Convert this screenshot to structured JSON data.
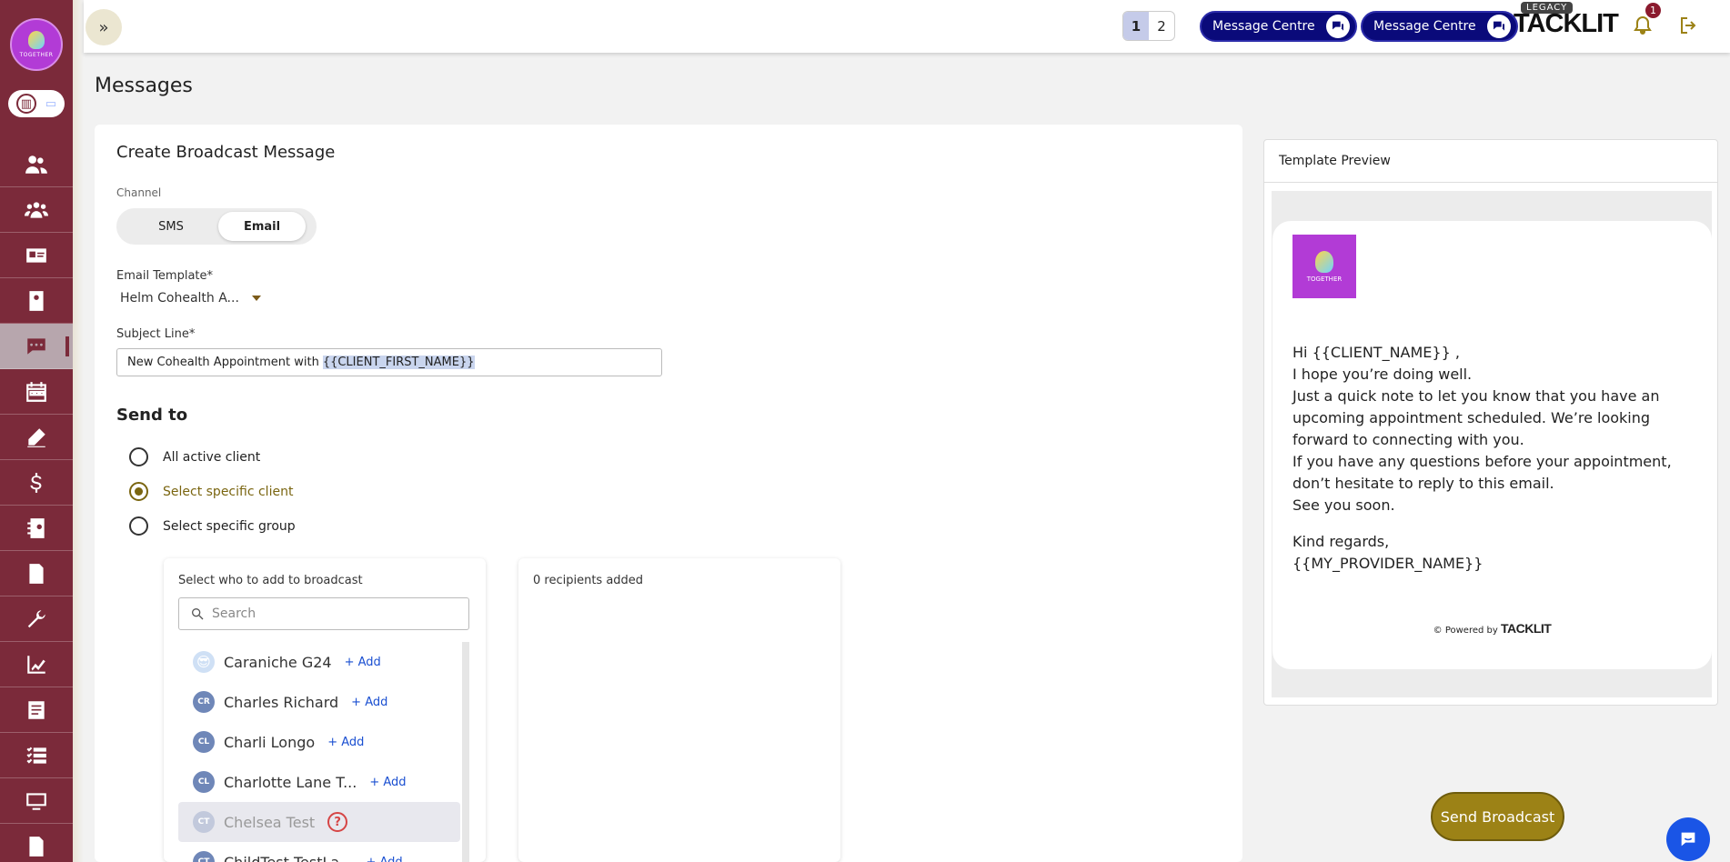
{
  "sidebar": {
    "logo_text": "TOGETHER",
    "nav_icons": [
      "people-icon",
      "group-icon",
      "id-card-icon",
      "profile-icon",
      "chat-icon",
      "calendar-icon",
      "pen-icon",
      "dollar-icon",
      "contact-book-icon",
      "document-icon",
      "wrench-icon",
      "chart-icon",
      "notes-icon",
      "checklist-icon",
      "monitor-icon",
      "file-icon"
    ],
    "active_index": 4
  },
  "header": {
    "pages": [
      "1",
      "2"
    ],
    "active_page": "1",
    "message_centre_label": "Message Centre",
    "legacy_message_centre_label": "Message Centre",
    "legacy_badge": "LEGACY",
    "brand": "TACKLIT",
    "notification_count": "1"
  },
  "page_title": "Messages",
  "form": {
    "title": "Create Broadcast Message",
    "channel_label": "Channel",
    "channels": {
      "sms": "SMS",
      "email": "Email"
    },
    "active_channel": "Email",
    "template_label": "Email Template*",
    "template_value": "Helm Cohealth A...",
    "subject_label": "Subject Line*",
    "subject_prefix": "New Cohealth Appointment with",
    "subject_placeholder": "{{CLIENT_FIRST_NAME}}",
    "send_to_title": "Send to",
    "send_options": [
      "All active client",
      "Select specific client",
      "Select specific group"
    ],
    "selected_option": "Select specific client"
  },
  "selector": {
    "heading": "Select who to add to broadcast",
    "search_placeholder": "Search",
    "add_label": "+ Add",
    "clients": [
      {
        "name": "Caraniche G24",
        "initials": "",
        "avatar": "emoji",
        "disabled": false
      },
      {
        "name": "Charles Richard",
        "initials": "CR",
        "avatar": "initials",
        "disabled": false
      },
      {
        "name": "Charli Longo",
        "initials": "CL",
        "avatar": "initials",
        "disabled": false
      },
      {
        "name": "Charlotte Lane T...",
        "initials": "CL",
        "avatar": "initials",
        "disabled": false
      },
      {
        "name": "Chelsea Test",
        "initials": "CT",
        "avatar": "initials",
        "disabled": true
      },
      {
        "name": "ChildTest TestLa...",
        "initials": "CT",
        "avatar": "initials",
        "disabled": false
      }
    ]
  },
  "recipients": {
    "heading": "0 recipients added"
  },
  "preview": {
    "title": "Template Preview",
    "logo_text": "TOGETHER",
    "greeting": "Hi {{CLIENT_NAME}} ,",
    "lines": [
      "I hope you’re doing well.",
      "Just a quick note to let you know that you have an upcoming appointment scheduled. We’re looking forward to connecting with you.",
      "If you have any questions before your appointment, don’t hesitate to reply to this email.",
      "See you soon."
    ],
    "signoff": "Kind regards,",
    "signature": "{{MY_PROVIDER_NAME}}",
    "powered_by": "© Powered by",
    "powered_brand": "TACKLIT"
  },
  "actions": {
    "send_label": "Send Broadcast"
  },
  "colors": {
    "sidebar": "#7b2a3a",
    "accent_gold": "#9c8216",
    "navy": "#0a0a7a",
    "link_blue": "#1a4fd1"
  }
}
